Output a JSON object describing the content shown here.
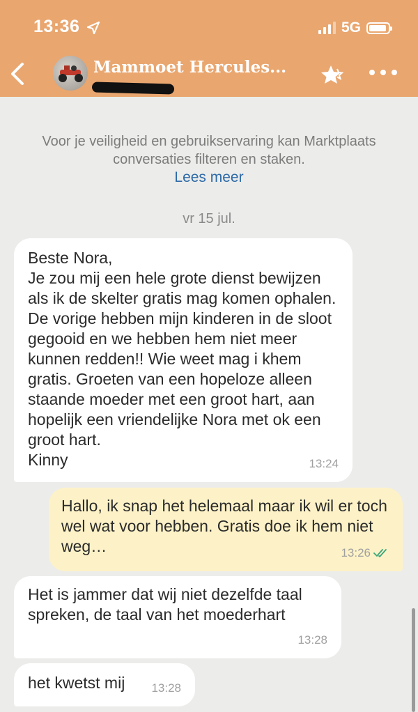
{
  "status_bar": {
    "time": "13:36",
    "network": "5G"
  },
  "header": {
    "contact_name": "Mammoet Hercules..."
  },
  "notice": {
    "text": "Voor je veiligheid en gebruikservaring kan Marktplaats conversaties filteren en staken.",
    "link": "Lees meer"
  },
  "date_separator": "vr 15 jul.",
  "messages": [
    {
      "direction": "incoming",
      "text": "Beste Nora,\nJe zou mij een hele grote dienst bewijzen als ik de skelter gratis mag komen ophalen. De vorige hebben mijn kinderen in de sloot gegooid en we hebben hem niet meer kunnen redden!! Wie weet mag i khem gratis. Groeten van een hopeloze alleen staande moeder met een groot hart, aan hopelijk een vriendelijke Nora met ok een groot hart.\nKinny",
      "time": "13:24"
    },
    {
      "direction": "outgoing",
      "text": "Hallo, ik snap het helemaal maar ik wil er toch wel wat voor hebben. Gratis doe ik hem niet weg…",
      "time": "13:26",
      "status": "read"
    },
    {
      "direction": "incoming",
      "text": "Het is jammer dat wij niet dezelfde taal spreken, de taal van het moederhart",
      "time": "13:28"
    },
    {
      "direction": "incoming",
      "text": "het kwetst mij",
      "time": "13:28"
    }
  ],
  "colors": {
    "header": "#e9a66f",
    "background": "#ececea",
    "incoming": "#ffffff",
    "outgoing": "#fdf2c7",
    "link": "#2e6ba8",
    "read_check": "#3aa57a"
  }
}
